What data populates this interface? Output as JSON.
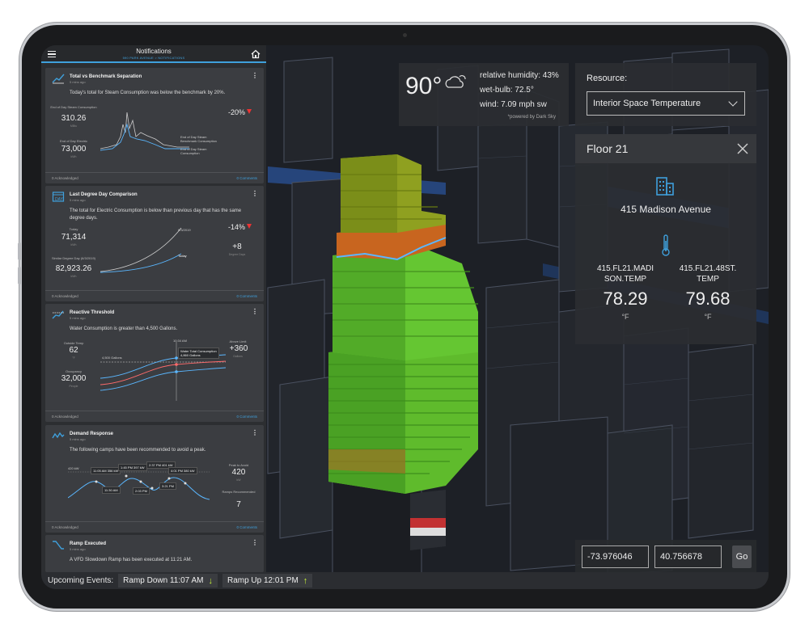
{
  "sidebar": {
    "title": "Notifications",
    "subtitle": "590 PARK AVENUE > NOTIFICATIONS",
    "cards": [
      {
        "title": "Total vs Benchmark Separation",
        "time": "5 mins ago",
        "message": "Today's total for Steam Consumption was below the benchmark by 20%.",
        "stat1_label": "End of Day Steam Consumption",
        "stat1_value": "310.26",
        "stat1_unit": "MBtu",
        "stat2_label": "End of Day Electric",
        "stat2_value": "73,000",
        "stat2_unit": "kWh",
        "pct": "-20%",
        "legend1": "End of Day Steam Benchmark Consumption",
        "legend2": "End of Day Steam Consumption",
        "ack": "0 Acknowledged",
        "comments": "0 Comments"
      },
      {
        "title": "Last Degree Day Comparison",
        "time": "5 mins ago",
        "message": "The total for Electric Consumption is below than previous day that has the same degree days.",
        "stat1_label": "Today",
        "stat1_value": "71,314",
        "stat1_unit": "kWh",
        "stat2_label": "Similar Degree Day (6/3/2019)",
        "stat2_value": "82,923.26",
        "stat2_unit": "kWh",
        "pct": "-14%",
        "dd_value": "+8",
        "dd_label": "Degree Days",
        "line_label1": "6/3/2019",
        "line_label2": "Today",
        "ack": "0 Acknowledged",
        "comments": "0 Comments"
      },
      {
        "title": "Reactive Threshold",
        "time": "5 mins ago",
        "message": "Water Consumption is greater than 4,500 Gallons.",
        "stat1_label": "Outside Temp",
        "stat1_value": "62",
        "stat1_unit": "°F",
        "stat2_label": "Occupancy",
        "stat2_value": "32,000",
        "stat2_unit": "People",
        "above_label": "Above Limit",
        "above_value": "+360",
        "above_unit": "Gallons",
        "time_label": "10:34 AM",
        "limit_label": "4,500 Gallons",
        "tip1": "Water Total Consumption",
        "tip2": "4,860 Gallons",
        "ack": "0 Acknowledged",
        "comments": "0 Comments"
      },
      {
        "title": "Demand Response",
        "time": "5 mins ago",
        "message": "The following camps have been recommended to avoid a peak.",
        "y_label": "420 kW",
        "peak_label": "Peak to Avoid",
        "peak_value": "420",
        "peak_unit": "kW",
        "ramps_label": "Ramps Recommended",
        "ramps_value": "7",
        "pills": [
          "11:05 AM 356 kW",
          "11:30 AM",
          "1:45 PM 397 kW",
          "2:03 PM",
          "2:37 PM 401 kW",
          "3:21 PM",
          "4:01 PM 380 kW"
        ],
        "ack": "0 Acknowledged",
        "comments": "0 Comments"
      },
      {
        "title": "Ramp Executed",
        "time": "5 mins ago",
        "message": "A VFD Slowdown Ramp has been executed at 11:21 AM."
      }
    ]
  },
  "weather": {
    "temp": "90°",
    "humidity": "relative humidity: 43%",
    "wetbulb": "wet-bulb: 72.5°",
    "wind": "wind: 7.09 mph sw",
    "powered": "*powered by Dark Sky"
  },
  "resource": {
    "label": "Resource:",
    "selected": "Interior Space Temperature"
  },
  "floor": {
    "title": "Floor 21",
    "address": "415 Madison Avenue",
    "sensors": [
      {
        "name": "415.FL21.MADI SON.TEMP",
        "value": "78.29",
        "unit": "°F"
      },
      {
        "name": "415.FL21.48ST. TEMP",
        "value": "79.68",
        "unit": "°F"
      }
    ]
  },
  "coords": {
    "longitude": "-73.976046",
    "latitude": "40.756678",
    "go_label": "Go"
  },
  "events": {
    "label": "Upcoming Events:",
    "items": [
      {
        "label": "Ramp Down 11:07 AM",
        "arrow": "↓"
      },
      {
        "label": "Ramp Up 12:01 PM",
        "arrow": "↑"
      }
    ]
  },
  "colors": {
    "accent": "#3fa0dc",
    "alert": "#ee3333",
    "highlight": "#c6f238"
  }
}
